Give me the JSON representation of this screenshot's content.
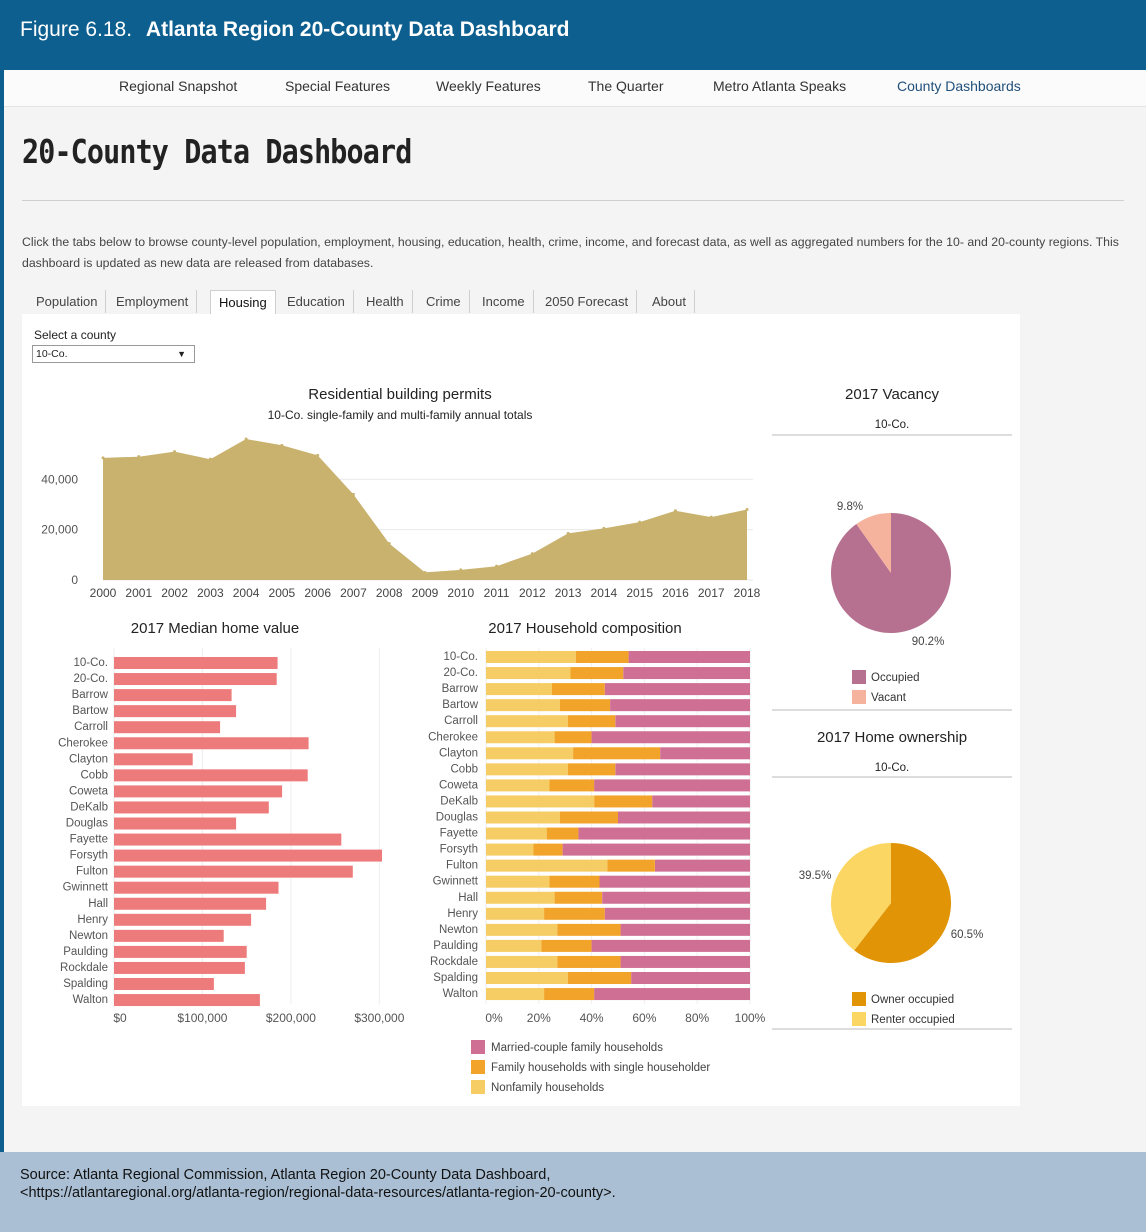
{
  "figure": {
    "number": "Figure 6.18.",
    "title": "Atlanta Region 20-County Data Dashboard"
  },
  "nav": {
    "items": [
      "Regional Snapshot",
      "Special Features",
      "Weekly Features",
      "The Quarter",
      "Metro Atlanta Speaks",
      "County Dashboards"
    ],
    "active": "County Dashboards"
  },
  "page": {
    "title": "20-County Data Dashboard",
    "intro": "Click the tabs below to browse county-level population, employment, housing, education, health, crime, income, and forecast data, as well as aggregated numbers for the 10- and 20-county regions. This dashboard is updated as new data are released from databases."
  },
  "tabs": {
    "items": [
      "Population",
      "Employment",
      "Housing",
      "Education",
      "Health",
      "Crime",
      "Income",
      "2050 Forecast",
      "About"
    ],
    "active": "Housing"
  },
  "county_select": {
    "label": "Select a county",
    "value": "10-Co."
  },
  "colors": {
    "header": "#0d5f8f",
    "area": "#c9b26e",
    "bar": "#ee7b7b",
    "married": "#cf6f94",
    "single": "#f2a42a",
    "nonfamily": "#f5cd64",
    "occupied": "#b5718f",
    "vacant": "#f5b29d",
    "owner": "#e09406",
    "renter": "#fbd662"
  },
  "chart_data": [
    {
      "type": "area",
      "title": "Residential building permits",
      "subtitle": "10-Co. single-family and multi-family annual totals",
      "x": [
        "2000",
        "2001",
        "2002",
        "2003",
        "2004",
        "2005",
        "2006",
        "2007",
        "2008",
        "2009",
        "2010",
        "2011",
        "2012",
        "2013",
        "2014",
        "2015",
        "2016",
        "2017",
        "2018"
      ],
      "values": [
        48500,
        49000,
        51000,
        48000,
        56000,
        53500,
        49500,
        34000,
        14500,
        3000,
        4000,
        5500,
        10500,
        18500,
        20500,
        23000,
        27500,
        25000,
        28000
      ],
      "y_ticks": [
        "40,000",
        "20,000",
        "0"
      ],
      "ylim": [
        0,
        58000
      ],
      "grid": true
    },
    {
      "type": "bar",
      "orientation": "horizontal",
      "title": "2017 Median home value",
      "categories": [
        "10-Co.",
        "20-Co.",
        "Barrow",
        "Bartow",
        "Carroll",
        "Cherokee",
        "Clayton",
        "Cobb",
        "Coweta",
        "DeKalb",
        "Douglas",
        "Fayette",
        "Forsyth",
        "Fulton",
        "Gwinnett",
        "Hall",
        "Henry",
        "Newton",
        "Paulding",
        "Rockdale",
        "Spalding",
        "Walton"
      ],
      "values": [
        185000,
        184000,
        133000,
        138000,
        120000,
        220000,
        89000,
        219000,
        190000,
        175000,
        138000,
        257000,
        303000,
        270000,
        186000,
        172000,
        155000,
        124000,
        150000,
        148000,
        113000,
        165000
      ],
      "x_ticks": [
        "$0",
        "$100,000",
        "$200,000",
        "$300,000"
      ],
      "xlim": [
        0,
        300000
      ],
      "grid": true
    },
    {
      "type": "bar",
      "orientation": "horizontal",
      "stacked": true,
      "title": "2017 Household composition",
      "categories": [
        "10-Co.",
        "20-Co.",
        "Barrow",
        "Bartow",
        "Carroll",
        "Cherokee",
        "Clayton",
        "Cobb",
        "Coweta",
        "DeKalb",
        "Douglas",
        "Fayette",
        "Forsyth",
        "Fulton",
        "Gwinnett",
        "Hall",
        "Henry",
        "Newton",
        "Paulding",
        "Rockdale",
        "Spalding",
        "Walton"
      ],
      "series": [
        {
          "name": "Nonfamily households",
          "values": [
            34,
            32,
            25,
            28,
            31,
            26,
            33,
            31,
            24,
            41,
            28,
            23,
            18,
            46,
            24,
            26,
            22,
            27,
            21,
            27,
            31,
            22
          ]
        },
        {
          "name": "Family households with single householder",
          "values": [
            20,
            20,
            20,
            19,
            18,
            14,
            33,
            18,
            17,
            22,
            22,
            12,
            11,
            18,
            19,
            18,
            23,
            24,
            19,
            24,
            24,
            19
          ]
        },
        {
          "name": "Married-couple family households",
          "values": [
            46,
            48,
            55,
            53,
            51,
            60,
            34,
            51,
            59,
            37,
            50,
            65,
            71,
            36,
            57,
            56,
            55,
            49,
            60,
            49,
            45,
            59
          ]
        }
      ],
      "x_ticks": [
        "0%",
        "20%",
        "40%",
        "60%",
        "80%",
        "100%"
      ],
      "legend": [
        "Married-couple family households",
        "Family households with single householder",
        "Nonfamily households"
      ],
      "legend_position": "bottom"
    },
    {
      "type": "pie",
      "title": "2017 Vacancy",
      "subtitle": "10-Co.",
      "labels": [
        "Occupied",
        "Vacant"
      ],
      "values": [
        90.2,
        9.8
      ],
      "value_labels": [
        "90.2%",
        "9.8%"
      ],
      "legend_position": "bottom"
    },
    {
      "type": "pie",
      "title": "2017 Home ownership",
      "subtitle": "10-Co.",
      "labels": [
        "Owner occupied",
        "Renter occupied"
      ],
      "values": [
        60.5,
        39.5
      ],
      "value_labels": [
        "60.5%",
        "39.5%"
      ],
      "legend_position": "bottom"
    }
  ],
  "source": {
    "line1": "Source: Atlanta Regional Commission, Atlanta Region 20-County Data Dashboard,",
    "line2": "<https://atlantaregional.org/atlanta-region/regional-data-resources/atlanta-region-20-county>."
  }
}
